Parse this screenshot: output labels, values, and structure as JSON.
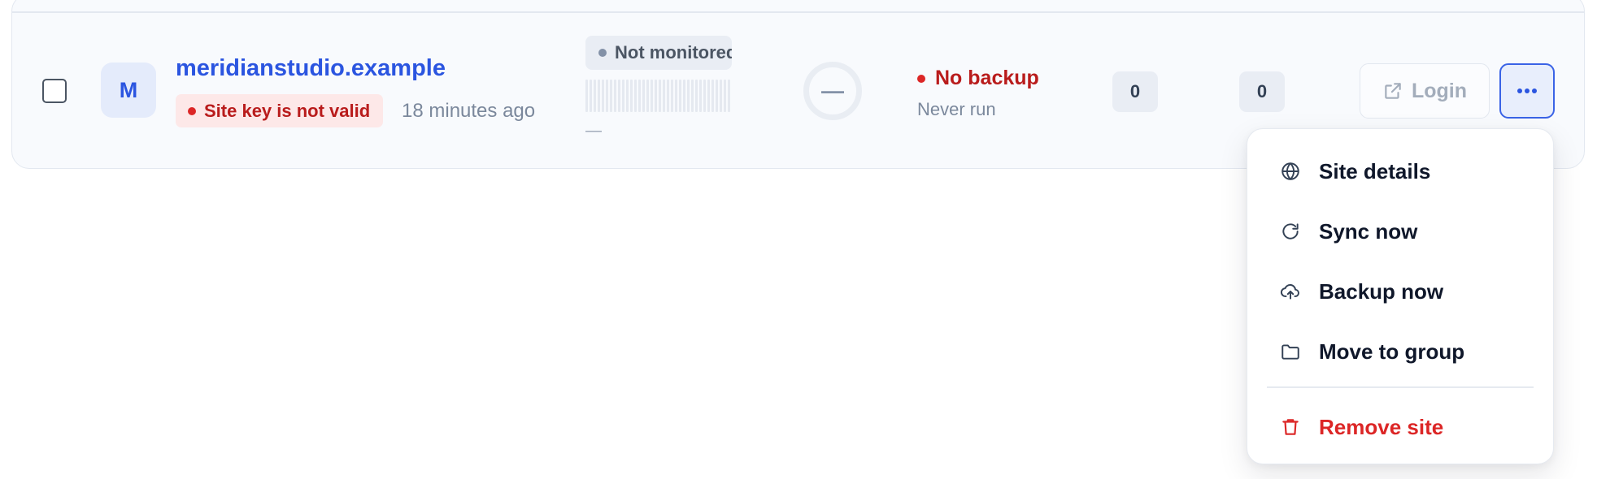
{
  "site": {
    "avatar_letter": "M",
    "name": "meridianstudio.example",
    "error_badge": "Site key is not valid",
    "last_seen": "18 minutes ago"
  },
  "monitoring": {
    "status": "Not monitored",
    "uptime_text": "—"
  },
  "score": {
    "value": "—"
  },
  "backup": {
    "status": "No backup",
    "last_run": "Never run"
  },
  "counts": {
    "first": "0",
    "second": "0"
  },
  "actions": {
    "login_label": "Login"
  },
  "menu": {
    "items": [
      {
        "label": "Site details",
        "icon": "globe-icon"
      },
      {
        "label": "Sync now",
        "icon": "refresh-icon"
      },
      {
        "label": "Backup now",
        "icon": "cloud-upload-icon"
      },
      {
        "label": "Move to group",
        "icon": "folder-icon"
      },
      {
        "label": "Remove site",
        "icon": "trash-icon"
      }
    ]
  },
  "colors": {
    "accent": "#2b55e0",
    "danger": "#dc2626",
    "error_bg": "#fde8e8"
  }
}
